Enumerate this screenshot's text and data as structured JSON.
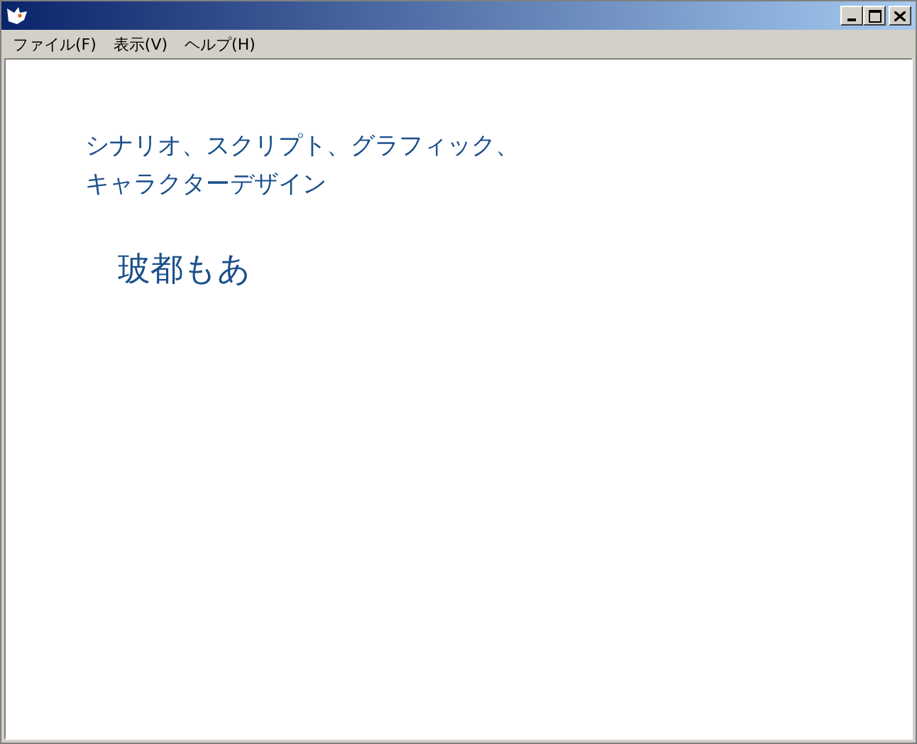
{
  "window": {
    "title_buttons": [
      {
        "kind": "minimize"
      },
      {
        "kind": "maximize"
      },
      {
        "kind": "close"
      }
    ]
  },
  "menu": [
    {
      "label": "ファイル(F)"
    },
    {
      "label": "表示(V)"
    },
    {
      "label": "ヘルプ(H)"
    }
  ],
  "credit": {
    "role_lines": [
      "シナリオ、スクリプト、グラフィック、",
      "キャラクターデザイン"
    ],
    "name": "玻都もあ"
  }
}
